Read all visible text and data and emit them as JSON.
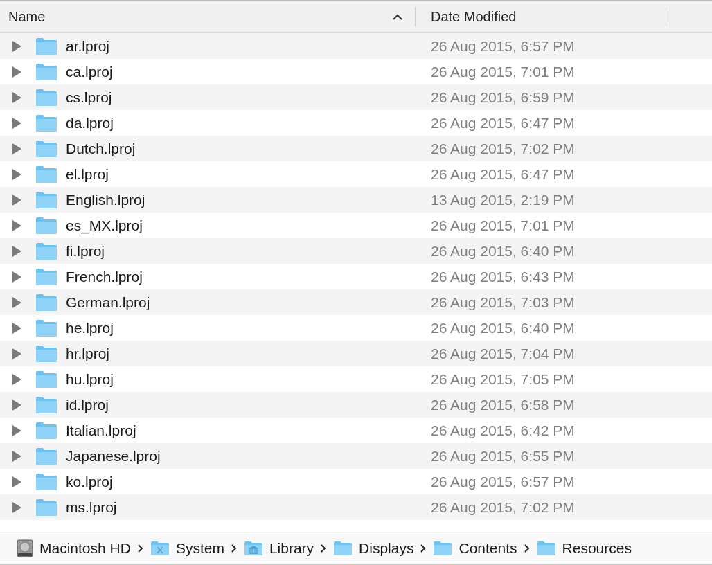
{
  "columns": [
    {
      "label": "Name",
      "sorted": true
    },
    {
      "label": "Date Modified",
      "sorted": false
    }
  ],
  "rows": [
    {
      "name": "ar.lproj",
      "date": "26 Aug 2015, 6:57 PM",
      "expanded": false
    },
    {
      "name": "ca.lproj",
      "date": "26 Aug 2015, 7:01 PM",
      "expanded": false
    },
    {
      "name": "cs.lproj",
      "date": "26 Aug 2015, 6:59 PM",
      "expanded": false
    },
    {
      "name": "da.lproj",
      "date": "26 Aug 2015, 6:47 PM",
      "expanded": false
    },
    {
      "name": "Dutch.lproj",
      "date": "26 Aug 2015, 7:02 PM",
      "expanded": false
    },
    {
      "name": "el.lproj",
      "date": "26 Aug 2015, 6:47 PM",
      "expanded": false
    },
    {
      "name": "English.lproj",
      "date": "13 Aug 2015, 2:19 PM",
      "expanded": false
    },
    {
      "name": "es_MX.lproj",
      "date": "26 Aug 2015, 7:01 PM",
      "expanded": false
    },
    {
      "name": "fi.lproj",
      "date": "26 Aug 2015, 6:40 PM",
      "expanded": false
    },
    {
      "name": "French.lproj",
      "date": "26 Aug 2015, 6:43 PM",
      "expanded": false
    },
    {
      "name": "German.lproj",
      "date": "26 Aug 2015, 7:03 PM",
      "expanded": false
    },
    {
      "name": "he.lproj",
      "date": "26 Aug 2015, 6:40 PM",
      "expanded": false
    },
    {
      "name": "hr.lproj",
      "date": "26 Aug 2015, 7:04 PM",
      "expanded": false
    },
    {
      "name": "hu.lproj",
      "date": "26 Aug 2015, 7:05 PM",
      "expanded": false
    },
    {
      "name": "id.lproj",
      "date": "26 Aug 2015, 6:58 PM",
      "expanded": false
    },
    {
      "name": "Italian.lproj",
      "date": "26 Aug 2015, 6:42 PM",
      "expanded": false
    },
    {
      "name": "Japanese.lproj",
      "date": "26 Aug 2015, 6:55 PM",
      "expanded": false
    },
    {
      "name": "ko.lproj",
      "date": "26 Aug 2015, 6:57 PM",
      "expanded": false
    },
    {
      "name": "ms.lproj",
      "date": "26 Aug 2015, 7:02 PM",
      "expanded": false
    }
  ],
  "path_bar": [
    {
      "label": "Macintosh HD",
      "kind": "drive"
    },
    {
      "label": "System",
      "kind": "system"
    },
    {
      "label": "Library",
      "kind": "library"
    },
    {
      "label": "Displays",
      "kind": "folder"
    },
    {
      "label": "Contents",
      "kind": "folder"
    },
    {
      "label": "Resources",
      "kind": "folder"
    }
  ]
}
